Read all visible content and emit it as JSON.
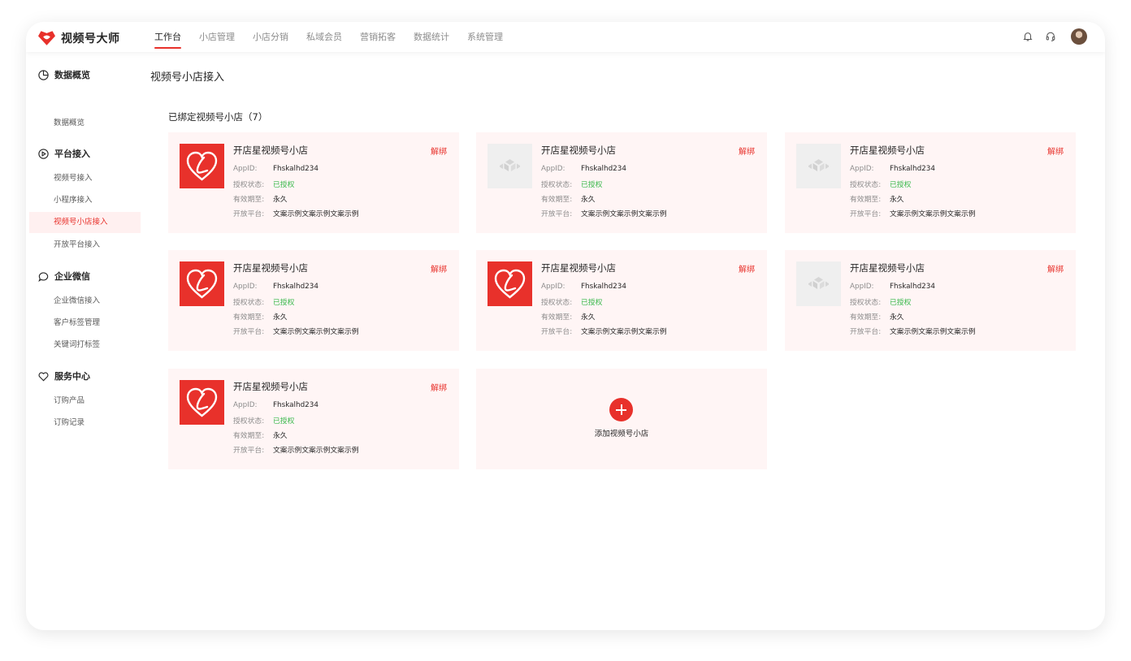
{
  "brand": {
    "name": "视频号大师",
    "color": "#e8312b"
  },
  "nav": [
    {
      "label": "工作台",
      "active": true
    },
    {
      "label": "小店管理"
    },
    {
      "label": "小店分销"
    },
    {
      "label": "私域会员"
    },
    {
      "label": "营销拓客"
    },
    {
      "label": "数据统计"
    },
    {
      "label": "系统管理"
    }
  ],
  "top_icons": [
    "bell-icon",
    "headset-icon",
    "avatar"
  ],
  "sidebar": {
    "groups": [
      {
        "title": "数据概览",
        "icon": "pie-chart-icon",
        "items": [
          "数据概览"
        ]
      },
      {
        "title": "平台接入",
        "icon": "play-circle-icon",
        "items": [
          "视频号接入",
          "小程序接入",
          "视频号小店接入",
          "开放平台接入"
        ]
      },
      {
        "title": "企业微信",
        "icon": "chat-bubble-icon",
        "items": [
          "企业微信接入",
          "客户标签管理",
          "关键词打标签"
        ]
      },
      {
        "title": "服务中心",
        "icon": "heart-icon",
        "items": [
          "订购产品",
          "订购记录"
        ]
      }
    ],
    "active_item": "视频号小店接入"
  },
  "main": {
    "page_title": "视频号小店接入",
    "section_title": "已绑定视频号小店（7）",
    "field_labels": {
      "appid": "AppID:",
      "auth": "授权状态:",
      "expire": "有效期至:",
      "platform": "开放平台:"
    },
    "cards": [
      {
        "name": "开店星视频号小店",
        "unbind": "解绑",
        "appid": "Fhskalhd234",
        "auth": "已授权",
        "expire": "永久",
        "platform": "文案示例文案示例文案示例",
        "thumb": "brand"
      },
      {
        "name": "开店星视频号小店",
        "unbind": "解绑",
        "appid": "Fhskalhd234",
        "auth": "已授权",
        "expire": "永久",
        "platform": "文案示例文案示例文案示例",
        "thumb": "placeholder"
      },
      {
        "name": "开店星视频号小店",
        "unbind": "解绑",
        "appid": "Fhskalhd234",
        "auth": "已授权",
        "expire": "永久",
        "platform": "文案示例文案示例文案示例",
        "thumb": "placeholder"
      },
      {
        "name": "开店星视频号小店",
        "unbind": "解绑",
        "appid": "Fhskalhd234",
        "auth": "已授权",
        "expire": "永久",
        "platform": "文案示例文案示例文案示例",
        "thumb": "brand"
      },
      {
        "name": "开店星视频号小店",
        "unbind": "解绑",
        "appid": "Fhskalhd234",
        "auth": "已授权",
        "expire": "永久",
        "platform": "文案示例文案示例文案示例",
        "thumb": "brand"
      },
      {
        "name": "开店星视频号小店",
        "unbind": "解绑",
        "appid": "Fhskalhd234",
        "auth": "已授权",
        "expire": "永久",
        "platform": "文案示例文案示例文案示例",
        "thumb": "placeholder"
      },
      {
        "name": "开店星视频号小店",
        "unbind": "解绑",
        "appid": "Fhskalhd234",
        "auth": "已授权",
        "expire": "永久",
        "platform": "文案示例文案示例文案示例",
        "thumb": "brand"
      }
    ],
    "add_label": "添加视频号小店"
  },
  "colors": {
    "accent": "#e8312b",
    "authorized": "#38b84b",
    "card_bg": "#fff5f5",
    "active_bg": "#fff0f0"
  }
}
